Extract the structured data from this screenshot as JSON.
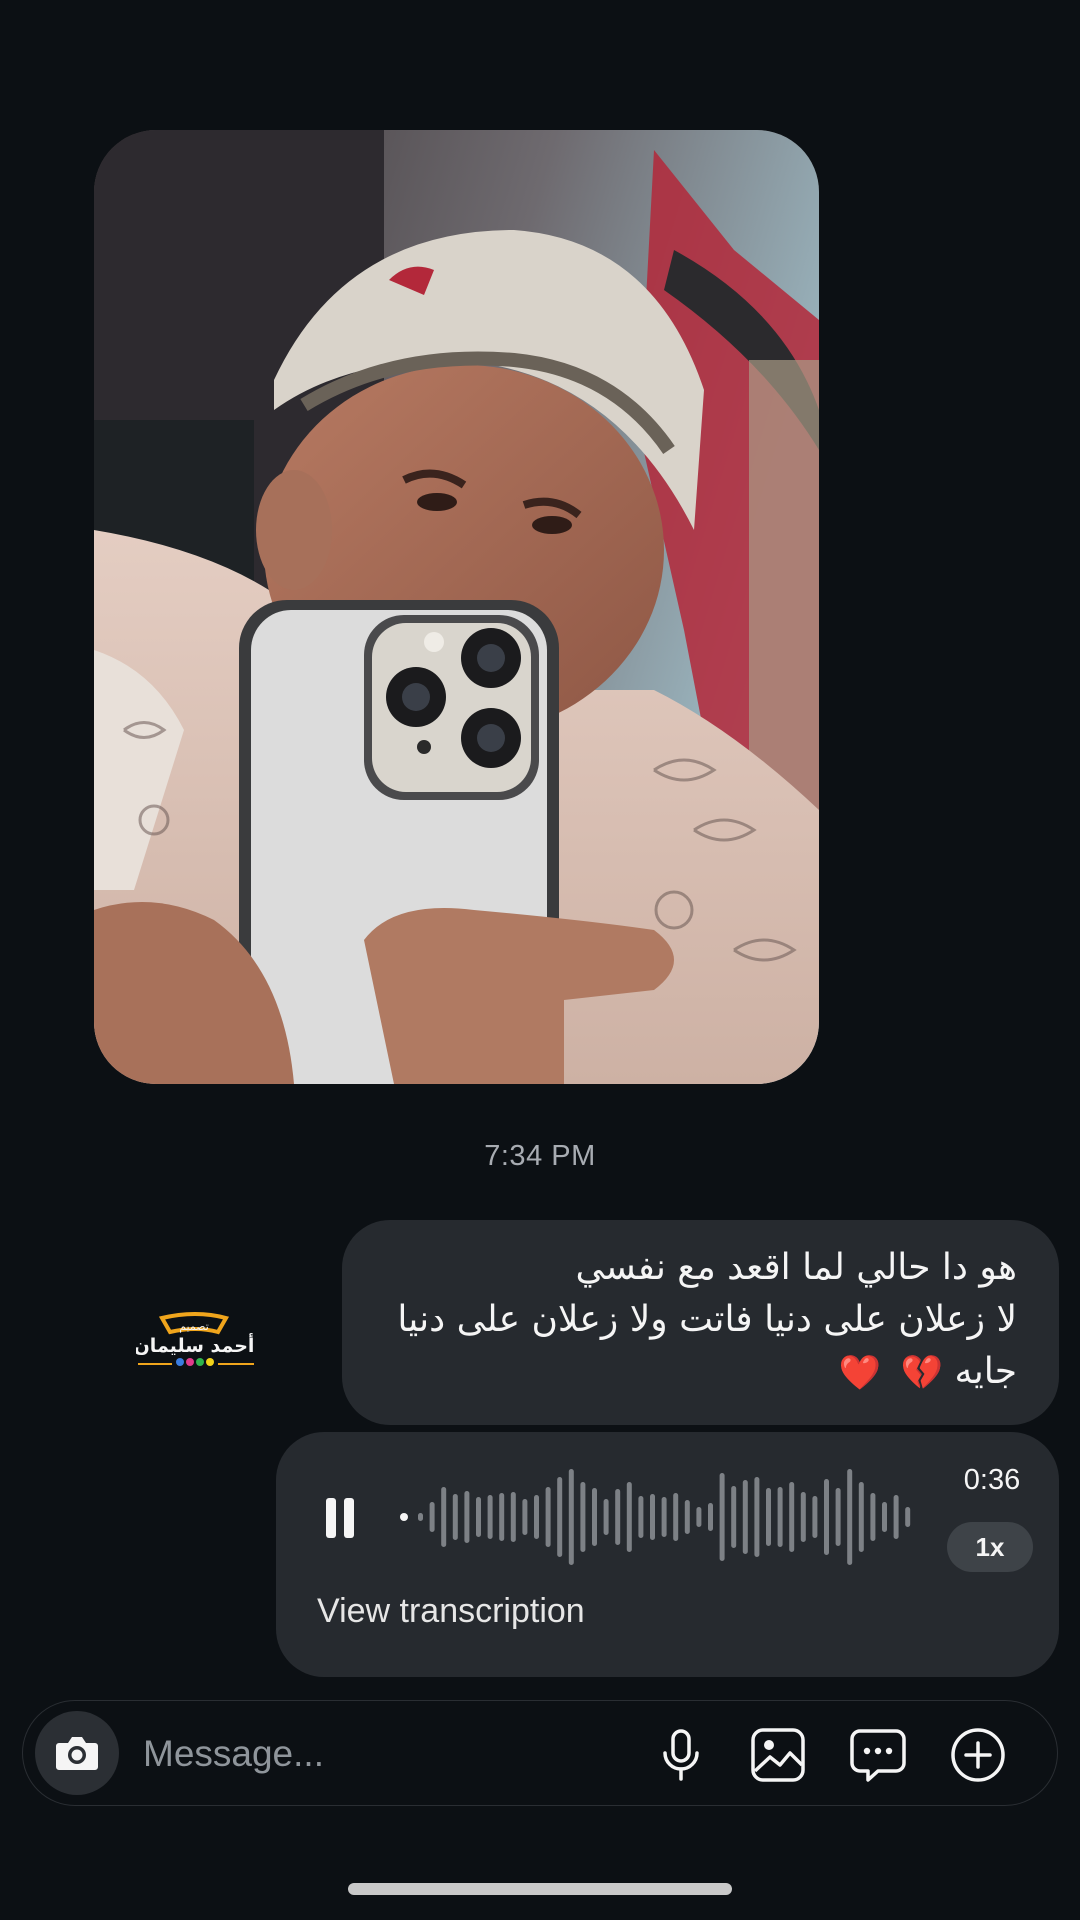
{
  "thread": {
    "timestamp": "7:34 PM",
    "photo_icon": "selfie-photo"
  },
  "text_message": {
    "line1": "هو دا حالي لما اقعد مع نفسي",
    "line2": "لا زعلان على دنيا فاتت ولا زعلان على دنيا",
    "line3": "جايه",
    "emoji1": "💔",
    "emoji2": "❤️"
  },
  "watermark": {
    "top_text": "تصميم",
    "name": "أحمد سليمان"
  },
  "voice_message": {
    "duration": "0:36",
    "speed": "1x",
    "transcription_link": "View transcription",
    "state_icon": "pause-icon"
  },
  "composer": {
    "placeholder": "Message...",
    "icons": [
      "camera-icon",
      "microphone-icon",
      "gallery-icon",
      "sticker-chat-icon",
      "plus-circle-icon"
    ]
  },
  "colors": {
    "background": "#0c1014",
    "bubble": "#262a2f",
    "muted_text": "#a8acb2"
  }
}
